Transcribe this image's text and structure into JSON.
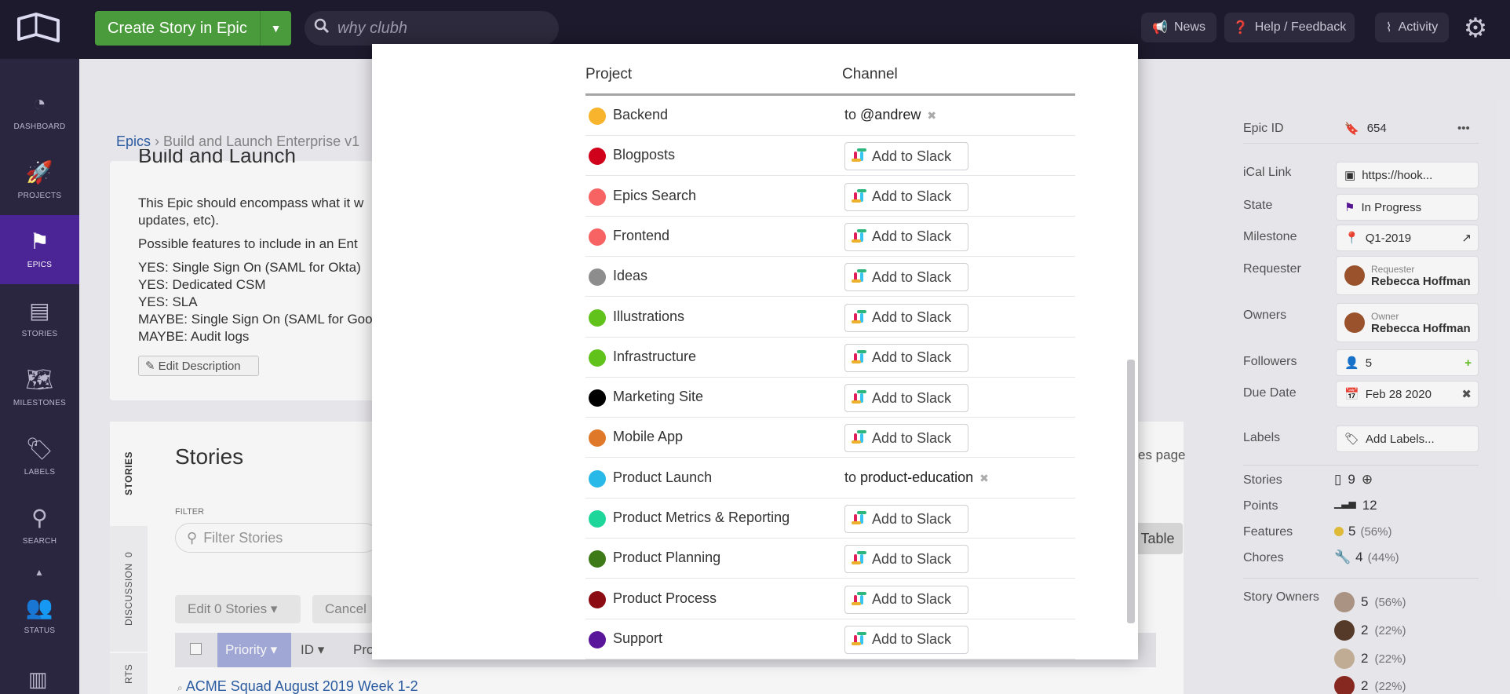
{
  "topbar": {
    "create_label": "Create Story in Epic",
    "search_placeholder": "why clubh",
    "news": "News",
    "help": "Help / Feedback",
    "activity": "Activity"
  },
  "sidebar": [
    {
      "label": "DASHBOARD",
      "icon": "dashboard-icon"
    },
    {
      "label": "PROJECTS",
      "icon": "rocket-icon"
    },
    {
      "label": "EPICS",
      "icon": "epics-flag-icon"
    },
    {
      "label": "STORIES",
      "icon": "stories-icon"
    },
    {
      "label": "MILESTONES",
      "icon": "map-icon"
    },
    {
      "label": "LABELS",
      "icon": "tag-icon"
    },
    {
      "label": "SEARCH",
      "icon": "search-icon"
    },
    {
      "label": "STATUS",
      "icon": "status-icon"
    }
  ],
  "breadcrumb": {
    "root": "Epics",
    "current": "Build and Launch Enterprise v1"
  },
  "description": {
    "title": "Build and Launch",
    "p1": "This Epic should encompass what it w",
    "p1b": "updates, etc).",
    "p2": "Possible features to include in an Ent",
    "lines": [
      "YES: Single Sign On (SAML for Okta)",
      "YES: Dedicated CSM",
      "YES: SLA",
      "MAYBE: Single Sign On (SAML for Goo",
      "MAYBE: Audit logs"
    ],
    "edit": "Edit Description"
  },
  "stories_panel": {
    "title": "Stories",
    "filter_label": "FILTER",
    "filter_placeholder": "Filter Stories",
    "edit_stories": "Edit 0 Stories",
    "cancel": "Cancel",
    "col_priority": "Priority",
    "col_id": "ID",
    "col_pro": "Pro",
    "row1": "ACME Squad August 2019 Week 1-2",
    "right_text": "es page",
    "table_btn": "Table",
    "tab_stories": "STORIES",
    "tab_discussion": "DISCUSSION",
    "discussion_count": "0",
    "tab_rts": "RTS"
  },
  "right_panel": {
    "epic_id_label": "Epic ID",
    "epic_id": "654",
    "ical_label": "iCal Link",
    "ical": "https://hook...",
    "state_label": "State",
    "state": "In Progress",
    "milestone_label": "Milestone",
    "milestone": "Q1-2019",
    "requester_label": "Requester",
    "requester_role": "Requester",
    "requester_name": "Rebecca Hoffman",
    "owners_label": "Owners",
    "owner_role": "Owner",
    "owner_name": "Rebecca Hoffman",
    "followers_label": "Followers",
    "followers": "5",
    "due_label": "Due Date",
    "due": "Feb 28 2020",
    "labels_label": "Labels",
    "labels": "Add Labels...",
    "stories_label": "Stories",
    "stories": "9",
    "points_label": "Points",
    "points": "12",
    "features_label": "Features",
    "features": "5",
    "features_pct": "(56%)",
    "chores_label": "Chores",
    "chores": "4",
    "chores_pct": "(44%)",
    "story_owners_label": "Story Owners",
    "owners_stats": [
      {
        "n": "5",
        "pct": "(56%)"
      },
      {
        "n": "2",
        "pct": "(22%)"
      },
      {
        "n": "2",
        "pct": "(22%)"
      },
      {
        "n": "2",
        "pct": "(22%)"
      }
    ]
  },
  "modal": {
    "col_project": "Project",
    "col_channel": "Channel",
    "add_label": "Add to Slack",
    "to": "to",
    "rows": [
      {
        "name": "Backend",
        "color": "#f7b42c",
        "channel": "@andrew"
      },
      {
        "name": "Blogposts",
        "color": "#d0021b",
        "channel": null
      },
      {
        "name": "Epics Search",
        "color": "#f76363",
        "channel": null
      },
      {
        "name": "Frontend",
        "color": "#f76363",
        "channel": null
      },
      {
        "name": "Ideas",
        "color": "#8d8d8d",
        "channel": null
      },
      {
        "name": "Illustrations",
        "color": "#62c21c",
        "channel": null
      },
      {
        "name": "Infrastructure",
        "color": "#62c21c",
        "channel": null
      },
      {
        "name": "Marketing Site",
        "color": "#000000",
        "channel": null
      },
      {
        "name": "Mobile App",
        "color": "#e0782a",
        "channel": null
      },
      {
        "name": "Product Launch",
        "color": "#29b9e8",
        "channel": "product-education"
      },
      {
        "name": "Product Metrics & Reporting",
        "color": "#1ed69a",
        "channel": null
      },
      {
        "name": "Product Planning",
        "color": "#3e7a18",
        "channel": null
      },
      {
        "name": "Product Process",
        "color": "#8b0c12",
        "channel": null
      },
      {
        "name": "Support",
        "color": "#5a169a",
        "channel": null
      }
    ]
  }
}
